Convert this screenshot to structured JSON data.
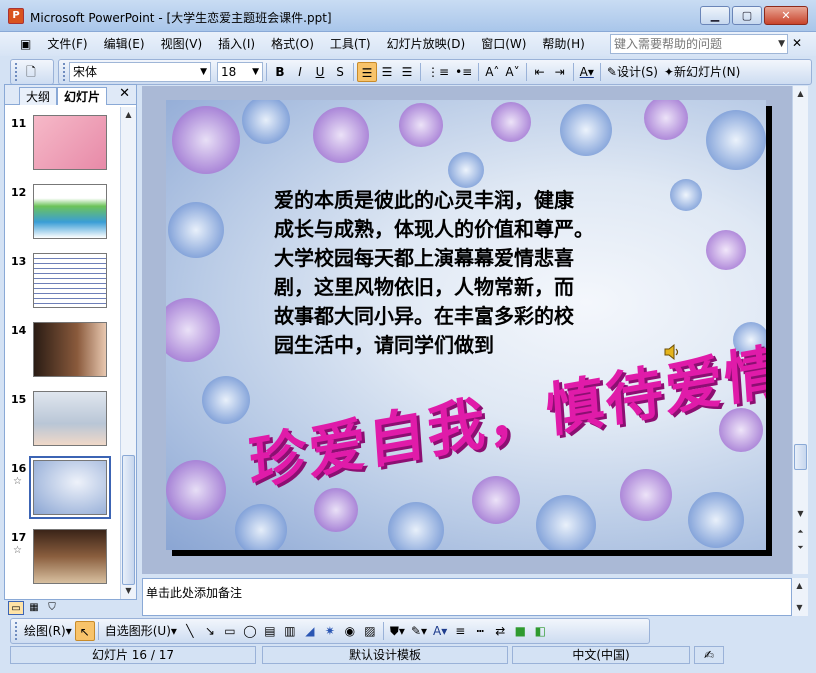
{
  "window": {
    "title": "Microsoft PowerPoint - [大学生恋爱主题班会课件.ppt]"
  },
  "menu": [
    "文件(F)",
    "编辑(E)",
    "视图(V)",
    "插入(I)",
    "格式(O)",
    "工具(T)",
    "幻灯片放映(D)",
    "窗口(W)",
    "帮助(H)"
  ],
  "help": {
    "placeholder": "键入需要帮助的问题"
  },
  "formatting": {
    "font": "宋体",
    "size": "18",
    "design": "设计(S)",
    "new_slide": "新幻灯片(N)"
  },
  "left_pane": {
    "tab_outline": "大纲",
    "tab_slides": "幻灯片"
  },
  "slides": [
    {
      "num": "11",
      "star": ""
    },
    {
      "num": "12",
      "star": ""
    },
    {
      "num": "13",
      "star": ""
    },
    {
      "num": "14",
      "star": ""
    },
    {
      "num": "15",
      "star": ""
    },
    {
      "num": "16",
      "star": "☆",
      "selected": true
    },
    {
      "num": "17",
      "star": "☆"
    }
  ],
  "slide": {
    "lines": [
      "爱的本质是彼此的心灵丰润，健康",
      "成长与成熟，体现人的价值和尊严。",
      "大学校园每天都上演幕幕爱情悲喜",
      "剧，这里风物依旧，人物常新，而",
      "故事都大同小异。在丰富多彩的校",
      "园生活中，请同学们做到"
    ],
    "wordart": "珍爱自我，慎待爱情"
  },
  "notes": {
    "placeholder": "单击此处添加备注"
  },
  "drawing": {
    "draw": "绘图(R)",
    "autoshape": "自选图形(U)"
  },
  "status": {
    "slide": "幻灯片 16 / 17",
    "template": "默认设计模板",
    "language": "中文(中国)"
  }
}
